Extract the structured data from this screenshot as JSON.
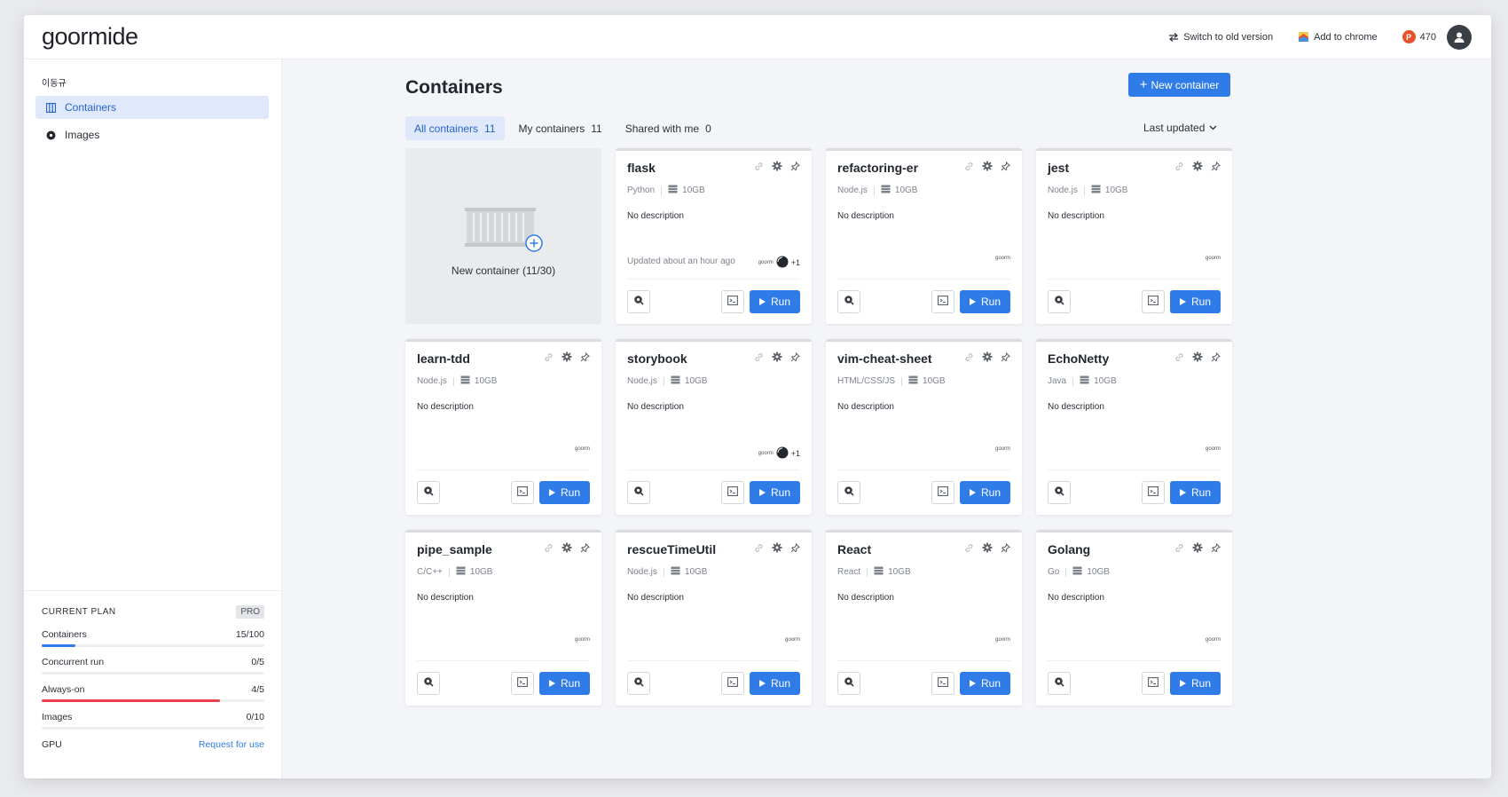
{
  "header": {
    "logo": "goormide",
    "switch_label": "Switch to old version",
    "chrome_label": "Add to chrome",
    "points_badge": "P",
    "points_value": "470"
  },
  "sidebar": {
    "user_name": "이동규",
    "nav": [
      {
        "label": "Containers",
        "icon": "grid-icon",
        "active": true
      },
      {
        "label": "Images",
        "icon": "disc-icon",
        "active": false
      }
    ],
    "plan": {
      "title": "CURRENT PLAN",
      "badge": "PRO",
      "rows": [
        {
          "label": "Containers",
          "value": "15/100",
          "progress": 0.15,
          "color": "#2f7be7"
        },
        {
          "label": "Concurrent run",
          "value": "0/5",
          "progress": 0.0,
          "color": "#2f7be7"
        },
        {
          "label": "Always-on",
          "value": "4/5",
          "progress": 0.8,
          "color": "#e8414b"
        },
        {
          "label": "Images",
          "value": "0/10",
          "progress": 0.0,
          "color": "#2f7be7"
        }
      ],
      "gpu_label": "GPU",
      "gpu_link": "Request for use"
    }
  },
  "main": {
    "title": "Containers",
    "new_button": "New container",
    "tabs": [
      {
        "label": "All containers",
        "count": "11",
        "active": true
      },
      {
        "label": "My containers",
        "count": "11",
        "active": false
      },
      {
        "label": "Shared with me",
        "count": "0",
        "active": false
      }
    ],
    "sort_label": "Last updated",
    "new_card_label": "New container (11/30)",
    "run_label": "Run",
    "containers": [
      {
        "name": "flask",
        "stack": "Python",
        "disk": "10GB",
        "description": "No description",
        "updated": "Updated about an hour ago",
        "owner": "goorm",
        "extra": "+1"
      },
      {
        "name": "refactoring-er",
        "stack": "Node.js",
        "disk": "10GB",
        "description": "No description",
        "updated": "",
        "owner": "goorm",
        "extra": ""
      },
      {
        "name": "jest",
        "stack": "Node.js",
        "disk": "10GB",
        "description": "No description",
        "updated": "",
        "owner": "goorm",
        "extra": ""
      },
      {
        "name": "learn-tdd",
        "stack": "Node.js",
        "disk": "10GB",
        "description": "No description",
        "updated": "",
        "owner": "goorm",
        "extra": ""
      },
      {
        "name": "storybook",
        "stack": "Node.js",
        "disk": "10GB",
        "description": "No description",
        "updated": "",
        "owner": "goorm",
        "extra": "+1"
      },
      {
        "name": "vim-cheat-sheet",
        "stack": "HTML/CSS/JS",
        "disk": "10GB",
        "description": "No description",
        "updated": "",
        "owner": "goorm",
        "extra": ""
      },
      {
        "name": "EchoNetty",
        "stack": "Java",
        "disk": "10GB",
        "description": "No description",
        "updated": "",
        "owner": "goorm",
        "extra": ""
      },
      {
        "name": "pipe_sample",
        "stack": "C/C++",
        "disk": "10GB",
        "description": "No description",
        "updated": "",
        "owner": "goorm",
        "extra": ""
      },
      {
        "name": "rescueTimeUtil",
        "stack": "Node.js",
        "disk": "10GB",
        "description": "No description",
        "updated": "",
        "owner": "goorm",
        "extra": ""
      },
      {
        "name": "React",
        "stack": "React",
        "disk": "10GB",
        "description": "No description",
        "updated": "",
        "owner": "goorm",
        "extra": ""
      },
      {
        "name": "Golang",
        "stack": "Go",
        "disk": "10GB",
        "description": "No description",
        "updated": "",
        "owner": "goorm",
        "extra": ""
      }
    ]
  }
}
